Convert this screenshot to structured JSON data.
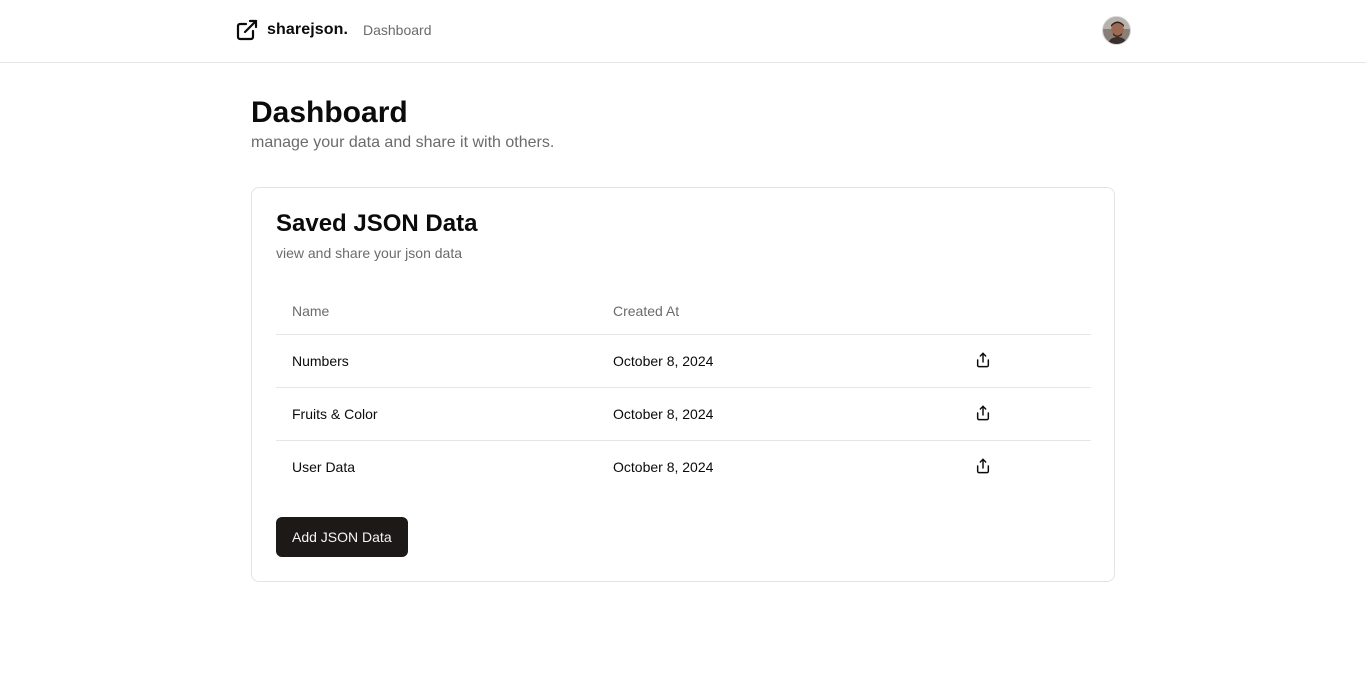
{
  "header": {
    "brand_name": "sharejson.",
    "nav_link": "Dashboard",
    "brand_icon": "external-link-icon",
    "avatar": "user-avatar"
  },
  "page": {
    "title": "Dashboard",
    "subtitle": "manage your data and share it with others."
  },
  "card": {
    "title": "Saved JSON Data",
    "description": "view and share your json data",
    "columns": [
      "Name",
      "Created At"
    ],
    "rows": [
      {
        "name": "Numbers",
        "created_at": "October 8, 2024",
        "action_icon": "share-icon"
      },
      {
        "name": "Fruits & Color",
        "created_at": "October 8, 2024",
        "action_icon": "share-icon"
      },
      {
        "name": "User Data",
        "created_at": "October 8, 2024",
        "action_icon": "share-icon"
      }
    ],
    "add_button_label": "Add JSON Data"
  },
  "colors": {
    "primary_button": "#1c1917",
    "muted_text": "#6b6b6b",
    "border": "#e6e6e6"
  }
}
